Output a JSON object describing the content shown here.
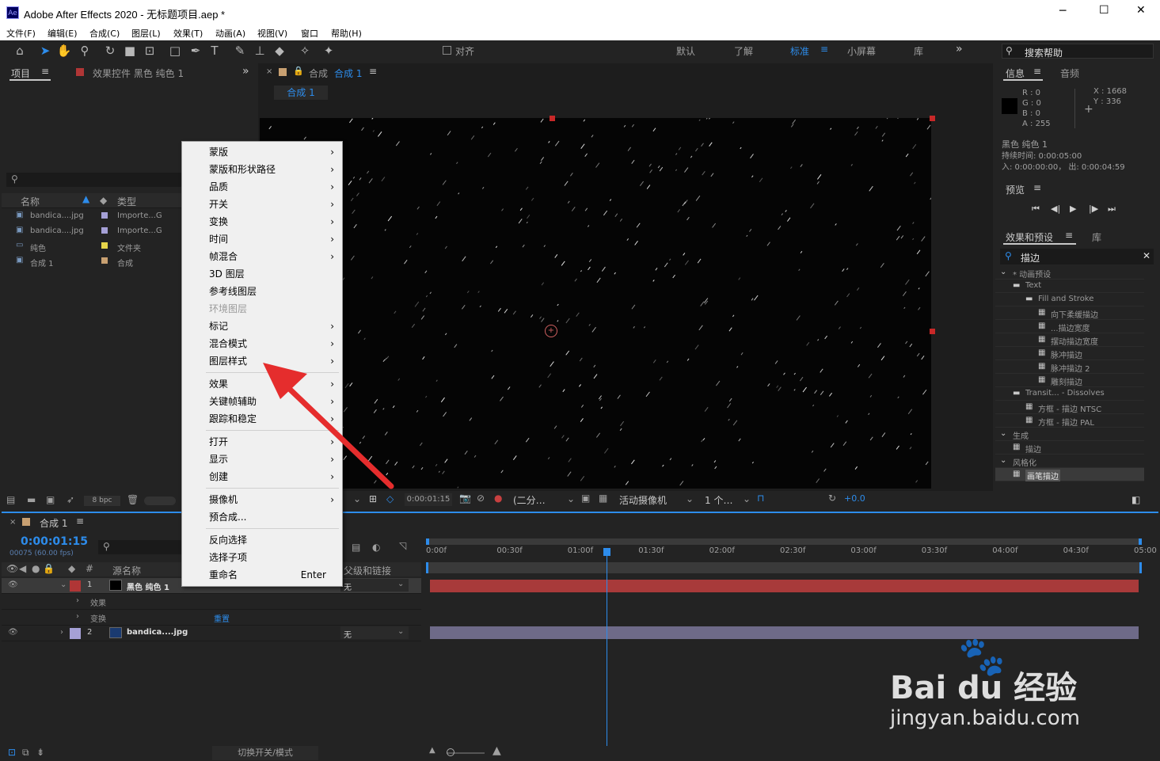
{
  "window": {
    "title": "Adobe After Effects 2020 - 无标题项目.aep *",
    "app_icon": "Ae",
    "controls": [
      "─",
      "☐",
      "✕"
    ]
  },
  "menu": [
    "文件(F)",
    "编辑(E)",
    "合成(C)",
    "图层(L)",
    "效果(T)",
    "动画(A)",
    "视图(V)",
    "窗口",
    "帮助(H)"
  ],
  "toolbar": {
    "align": "对齐",
    "workspaces": [
      "默认",
      "了解",
      "标准",
      "小屏幕",
      "库"
    ],
    "active_workspace": "标准",
    "overflow": "»",
    "search": "搜索帮助"
  },
  "project": {
    "tab": "项目",
    "effects_tab": "效果控件 黑色 纯色 1",
    "col_name": "名称",
    "col_type": "类型",
    "items": [
      {
        "name": "bandica....jpg",
        "type": "Importe...G",
        "color": "#a5a0d6"
      },
      {
        "name": "bandica....jpg",
        "type": "Importe...G",
        "color": "#a5a0d6"
      },
      {
        "name": "纯色",
        "type": "文件夹",
        "color": "#e6d54a"
      },
      {
        "name": "合成 1",
        "type": "合成",
        "color": "#c8a071"
      }
    ],
    "bpc": "8 bpc"
  },
  "comp": {
    "tab_prefix": "合成",
    "tab_name": "合成 1",
    "sub_tab": "合成 1",
    "timecode": "0:00:01:15",
    "resolution": "(二分…",
    "camera": "活动摄像机",
    "views": "1 个…",
    "exposure": "+0.0"
  },
  "context_menu": [
    {
      "label": "蒙版",
      "arrow": "›"
    },
    {
      "label": "蒙版和形状路径",
      "arrow": "›"
    },
    {
      "label": "品质",
      "arrow": "›"
    },
    {
      "label": "开关",
      "arrow": "›"
    },
    {
      "label": "变换",
      "arrow": "›"
    },
    {
      "label": "时间",
      "arrow": "›"
    },
    {
      "label": "帧混合",
      "arrow": "›"
    },
    {
      "label": "3D 图层"
    },
    {
      "label": "参考线图层"
    },
    {
      "label": "环境图层",
      "disabled": true
    },
    {
      "label": "标记",
      "arrow": "›"
    },
    {
      "label": "混合模式",
      "arrow": "›"
    },
    {
      "label": "图层样式",
      "arrow": "›",
      "sep_after": true
    },
    {
      "label": "效果",
      "arrow": "›"
    },
    {
      "label": "关键帧辅助",
      "arrow": "›"
    },
    {
      "label": "跟踪和稳定",
      "arrow": "›",
      "sep_after": true
    },
    {
      "label": "打开",
      "arrow": "›"
    },
    {
      "label": "显示",
      "arrow": "›"
    },
    {
      "label": "创建",
      "arrow": "›",
      "sep_after": true
    },
    {
      "label": "摄像机",
      "arrow": "›"
    },
    {
      "label": "预合成...",
      "sep_after": true
    },
    {
      "label": "反向选择"
    },
    {
      "label": "选择子项"
    },
    {
      "label": "重命名",
      "shortcut": "Enter"
    }
  ],
  "info": {
    "tab": "信息",
    "audio_tab": "音频",
    "r": "R : 0",
    "g": "G : 0",
    "b": "B : 0",
    "a": "A : 255",
    "x": "X : 1668",
    "y": "Y : 336",
    "layer": "黑色 纯色 1",
    "duration": "持续时间: 0:00:05:00",
    "inout": "入: 0:00:00:00， 出: 0:00:04:59"
  },
  "preview": {
    "tab": "预览",
    "buttons": [
      "⏮",
      "◀|",
      "▶",
      "|▶",
      "⏭"
    ]
  },
  "effects": {
    "tab": "效果和预设",
    "lib_tab": "库",
    "search": "描边",
    "tree": [
      {
        "label": "* 动画预设",
        "indent": 0,
        "kind": "arrow"
      },
      {
        "label": "Text",
        "indent": 1,
        "kind": "folder"
      },
      {
        "label": "Fill and Stroke",
        "indent": 2,
        "kind": "folder"
      },
      {
        "label": "向下柔缓描边",
        "indent": 3,
        "kind": "item"
      },
      {
        "label": "...描边宽度",
        "indent": 3,
        "kind": "item"
      },
      {
        "label": "摆动描边宽度",
        "indent": 3,
        "kind": "item"
      },
      {
        "label": "脉冲描边",
        "indent": 3,
        "kind": "item"
      },
      {
        "label": "脉冲描边 2",
        "indent": 3,
        "kind": "item"
      },
      {
        "label": "雕刻描边",
        "indent": 3,
        "kind": "item"
      },
      {
        "label": "Transit... - Dissolves",
        "indent": 1,
        "kind": "folder"
      },
      {
        "label": "方框 - 描边 NTSC",
        "indent": 2,
        "kind": "item"
      },
      {
        "label": "方框 - 描边 PAL",
        "indent": 2,
        "kind": "item"
      },
      {
        "label": "生成",
        "indent": 0,
        "kind": "arrow"
      },
      {
        "label": "描边",
        "indent": 1,
        "kind": "item"
      },
      {
        "label": "风格化",
        "indent": 0,
        "kind": "arrow"
      },
      {
        "label": "画笔描边",
        "indent": 1,
        "kind": "item",
        "selected": true
      }
    ]
  },
  "timeline": {
    "tab": "合成 1",
    "timecode": "0:00:01:15",
    "fps": "00075 (60.00 fps)",
    "col_src": "源名称",
    "col_parent": "父级和链接",
    "ruler": [
      "0:00f",
      "00:30f",
      "01:00f",
      "01:30f",
      "02:00f",
      "02:30f",
      "03:00f",
      "03:30f",
      "04:00f",
      "04:30f",
      "05:00"
    ],
    "layers": [
      {
        "num": "1",
        "name": "黑色 纯色 1",
        "parent": "无",
        "color": "#b03636"
      },
      {
        "sub": "效果"
      },
      {
        "sub": "变换",
        "reset": "重置"
      },
      {
        "num": "2",
        "name": "bandica....jpg",
        "parent": "无",
        "color": "#a5a0d6"
      }
    ],
    "footer": "切换开关/模式"
  },
  "watermark": {
    "brand": "Bai du 经验",
    "url": "jingyan.baidu.com"
  }
}
